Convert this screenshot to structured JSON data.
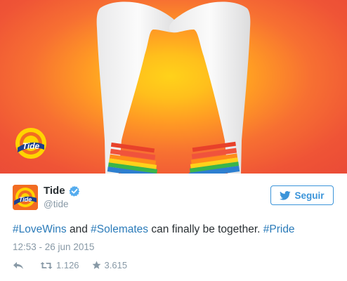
{
  "media": {
    "brand_logo_text": "Tide"
  },
  "tweet": {
    "author_name": "Tide",
    "author_handle": "@tide",
    "avatar_logo_text": "Tide",
    "follow_label": "Seguir",
    "text": {
      "tag1": "#LoveWins",
      "part1": " and ",
      "tag2": "#Solemates",
      "part2": " can finally be together. ",
      "tag3": "#Pride"
    },
    "timestamp": "12:53 - 26 jun 2015",
    "retweet_count": "1.126",
    "like_count": "3.615"
  },
  "icons": {
    "verified": "verified-badge-icon",
    "bird": "bird-icon",
    "reply": "reply-icon",
    "retweet": "retweet-icon",
    "like": "star-icon"
  },
  "colors": {
    "link": "#2b7bb9",
    "follow_border": "#3b94d9",
    "muted": "#8899a6",
    "text": "#292f33",
    "tide_orange": "#f26c22",
    "tide_yellow": "#ffd400"
  }
}
